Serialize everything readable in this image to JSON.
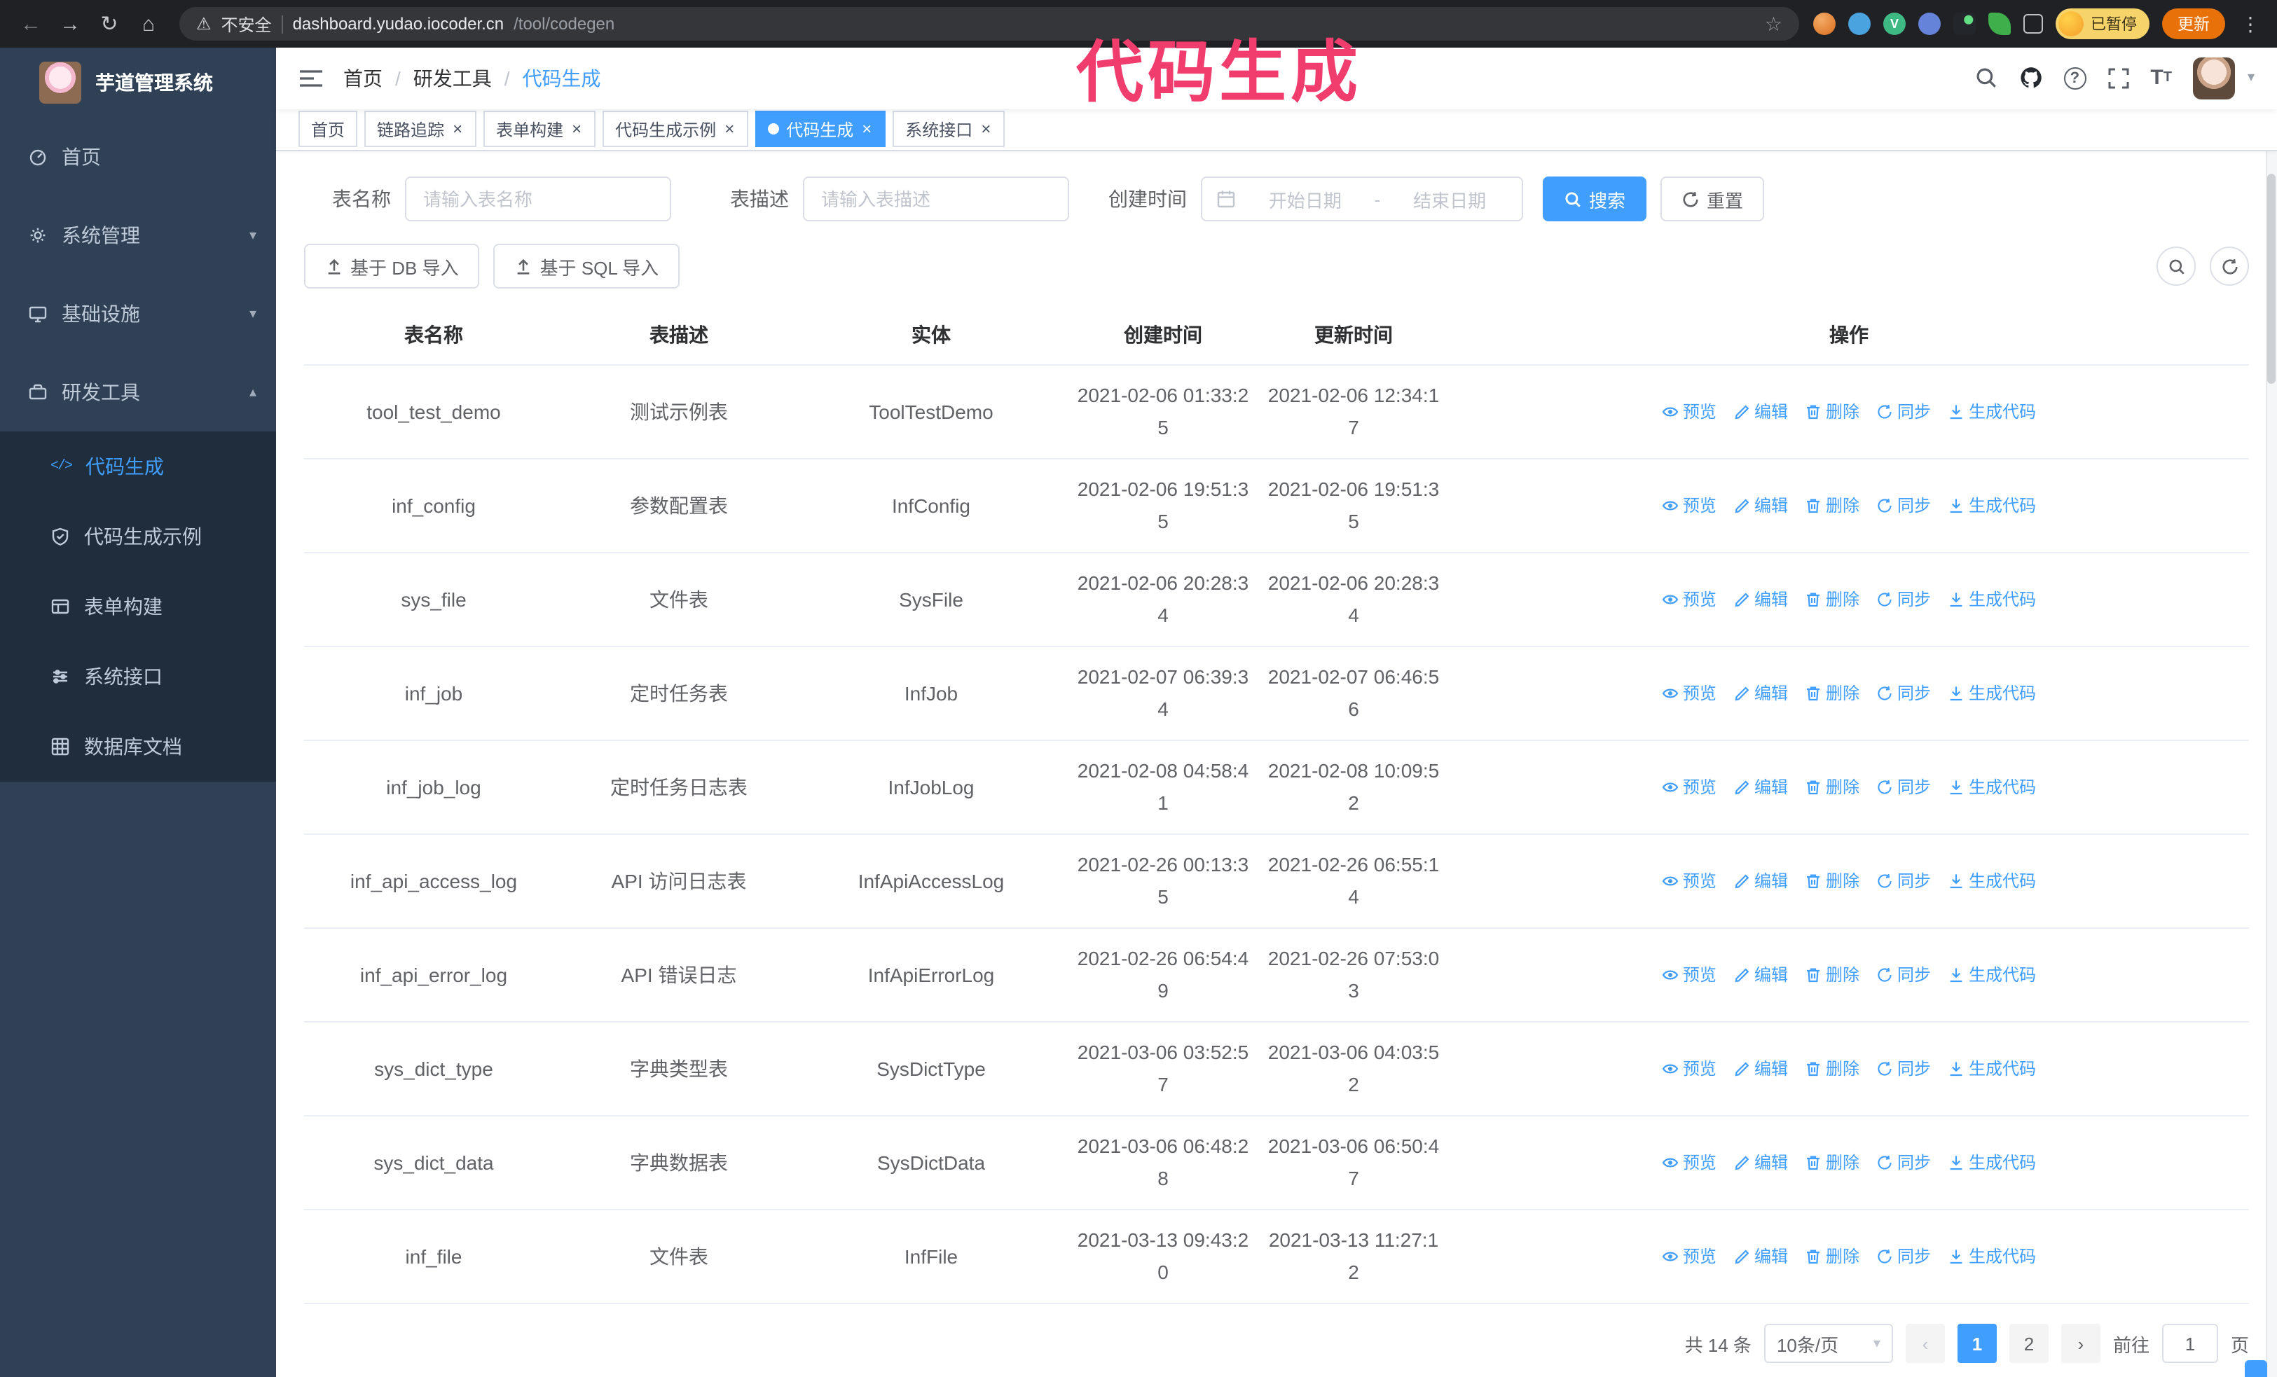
{
  "browser": {
    "security_label": "不安全",
    "url_domain": "dashboard.yudao.iocoder.cn",
    "url_path": "/tool/codegen",
    "paused_badge": "已暂停",
    "update_label": "更新"
  },
  "annotation": {
    "text": "代码生成",
    "color": "#f13c6e"
  },
  "icons": {
    "back": "←",
    "forward": "→",
    "reload": "↻",
    "home": "⌂",
    "warning": "⚠",
    "star": "☆",
    "menu_dots": "⋮",
    "close": "×",
    "chevron_down": "▾",
    "chevron_up": "▴",
    "prev": "‹",
    "next": "›",
    "question": "?",
    "code": "</>",
    "letter_T_big": "T",
    "letter_T_small": "T",
    "vue": "V"
  },
  "sidebar": {
    "logo_title": "芋道管理系统",
    "items": [
      {
        "label": "首页"
      },
      {
        "label": "系统管理"
      },
      {
        "label": "基础设施"
      },
      {
        "label": "研发工具"
      }
    ],
    "sub_items": [
      {
        "label": "代码生成"
      },
      {
        "label": "代码生成示例"
      },
      {
        "label": "表单构建"
      },
      {
        "label": "系统接口"
      },
      {
        "label": "数据库文档"
      }
    ]
  },
  "breadcrumb": {
    "separator": "/",
    "items": [
      "首页",
      "研发工具",
      "代码生成"
    ]
  },
  "tabs": [
    {
      "label": "首页"
    },
    {
      "label": "链路追踪"
    },
    {
      "label": "表单构建"
    },
    {
      "label": "代码生成示例"
    },
    {
      "label": "代码生成"
    },
    {
      "label": "系统接口"
    }
  ],
  "filters": {
    "table_name_label": "表名称",
    "table_name_placeholder": "请输入表名称",
    "table_desc_label": "表描述",
    "table_desc_placeholder": "请输入表描述",
    "create_time_label": "创建时间",
    "date_start_placeholder": "开始日期",
    "date_separator": "-",
    "date_end_placeholder": "结束日期",
    "search_button": "搜索",
    "reset_button": "重置"
  },
  "toolbar": {
    "import_db_label": "基于 DB 导入",
    "import_sql_label": "基于 SQL 导入"
  },
  "table": {
    "columns": [
      "表名称",
      "表描述",
      "实体",
      "创建时间",
      "更新时间",
      "操作"
    ],
    "actions": [
      "预览",
      "编辑",
      "删除",
      "同步",
      "生成代码"
    ],
    "rows": [
      {
        "name": "tool_test_demo",
        "desc": "测试示例表",
        "entity": "ToolTestDemo",
        "create_time": "2021-02-06 01:33:25",
        "update_time": "2021-02-06 12:34:17"
      },
      {
        "name": "inf_config",
        "desc": "参数配置表",
        "entity": "InfConfig",
        "create_time": "2021-02-06 19:51:35",
        "update_time": "2021-02-06 19:51:35"
      },
      {
        "name": "sys_file",
        "desc": "文件表",
        "entity": "SysFile",
        "create_time": "2021-02-06 20:28:34",
        "update_time": "2021-02-06 20:28:34"
      },
      {
        "name": "inf_job",
        "desc": "定时任务表",
        "entity": "InfJob",
        "create_time": "2021-02-07 06:39:34",
        "update_time": "2021-02-07 06:46:56"
      },
      {
        "name": "inf_job_log",
        "desc": "定时任务日志表",
        "entity": "InfJobLog",
        "create_time": "2021-02-08 04:58:41",
        "update_time": "2021-02-08 10:09:52"
      },
      {
        "name": "inf_api_access_log",
        "desc": "API 访问日志表",
        "entity": "InfApiAccessLog",
        "create_time": "2021-02-26 00:13:35",
        "update_time": "2021-02-26 06:55:14"
      },
      {
        "name": "inf_api_error_log",
        "desc": "API 错误日志",
        "entity": "InfApiErrorLog",
        "create_time": "2021-02-26 06:54:49",
        "update_time": "2021-02-26 07:53:03"
      },
      {
        "name": "sys_dict_type",
        "desc": "字典类型表",
        "entity": "SysDictType",
        "create_time": "2021-03-06 03:52:57",
        "update_time": "2021-03-06 04:03:52"
      },
      {
        "name": "sys_dict_data",
        "desc": "字典数据表",
        "entity": "SysDictData",
        "create_time": "2021-03-06 06:48:28",
        "update_time": "2021-03-06 06:50:47"
      },
      {
        "name": "inf_file",
        "desc": "文件表",
        "entity": "InfFile",
        "create_time": "2021-03-13 09:43:20",
        "update_time": "2021-03-13 11:27:12"
      }
    ]
  },
  "pagination": {
    "total_text": "共 14 条",
    "page_size_label": "10条/页",
    "pages": [
      "1",
      "2"
    ],
    "goto_label": "前往",
    "goto_value": "1",
    "goto_unit": "页"
  }
}
